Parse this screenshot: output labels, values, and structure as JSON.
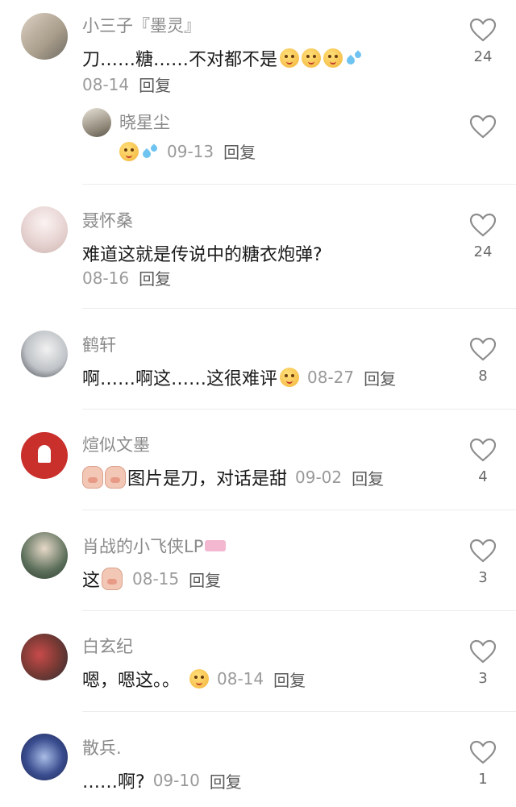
{
  "comments": [
    {
      "username": "小三子『墨灵』",
      "text": "刀……糖……不对都不是",
      "emojis": [
        "yellow-smile-emoji",
        "yellow-smile-emoji",
        "yellow-smile-emoji",
        "sweat-drop-emoji"
      ],
      "date": "08-14",
      "reply_label": "回复",
      "like_count": "24",
      "reply": {
        "username": "晓星尘",
        "emojis": [
          "yellow-smile-emoji",
          "sweat-drop-emoji"
        ],
        "date": "09-13",
        "reply_label": "回复"
      }
    },
    {
      "username": "聂怀桑",
      "text": "难道这就是传说中的糖衣炮弹?",
      "date": "08-16",
      "reply_label": "回复",
      "like_count": "24"
    },
    {
      "username": "鹤轩",
      "text": "啊……啊这……这很难评",
      "emojis": [
        "yellow-smile-emoji"
      ],
      "date": "08-27",
      "reply_label": "回复",
      "like_count": "8"
    },
    {
      "username": "煊似文墨",
      "text": "图片是刀，对话是甜",
      "emojis": [
        "pig-emoji",
        "pig-emoji"
      ],
      "date": "09-02",
      "reply_label": "回复",
      "like_count": "4"
    },
    {
      "username": "肖战的小飞侠LP",
      "text": "这",
      "emojis": [
        "pig-emoji"
      ],
      "date": "08-15",
      "reply_label": "回复",
      "like_count": "3"
    },
    {
      "username": "白玄纪",
      "text": "嗯，嗯这。。",
      "emojis": [
        "yellow-smile-emoji"
      ],
      "date": "08-14",
      "reply_label": "回复",
      "like_count": "3"
    },
    {
      "username": "散兵.",
      "text": "……啊?",
      "date": "09-10",
      "reply_label": "回复",
      "like_count": "1"
    }
  ],
  "icons": {
    "like": "heart-outline-icon",
    "badge": "pink-badge-icon"
  },
  "colors": {
    "username": "#8a8a8a",
    "text": "#1a1a1a",
    "meta": "#9a9a9a",
    "heart_stroke": "#8c8c8c"
  }
}
